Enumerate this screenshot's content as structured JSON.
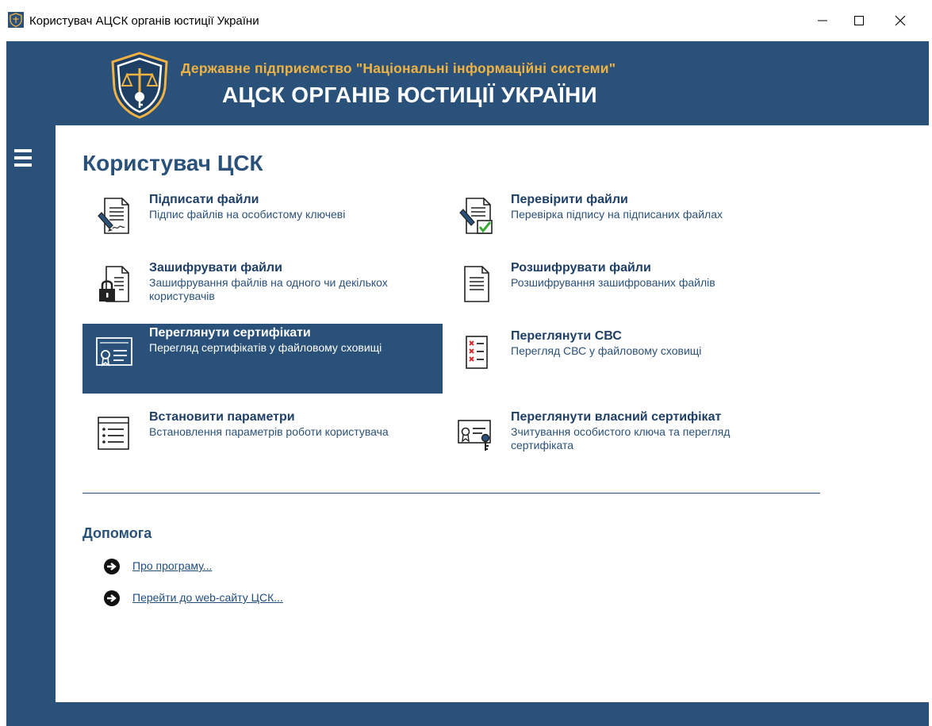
{
  "window": {
    "title": "Користувач АЦСК органів юстиції України",
    "controls": [
      "minimize",
      "maximize",
      "close"
    ]
  },
  "banner": {
    "subtitle": "Державне підприємство \"Національні інформаційні системи\"",
    "title": "АЦСК ОРГАНІВ ЮСТИЦІЇ УКРАЇНИ"
  },
  "page": {
    "title": "Користувач ЦСК"
  },
  "actions": [
    {
      "title": "Підписати файли",
      "description": "Підпис файлів на особистому ключеві",
      "icon": "sign-document-icon"
    },
    {
      "title": "Перевірити файли",
      "description": "Перевірка підпису на підписаних файлах",
      "icon": "verify-document-icon"
    },
    {
      "title": "Зашифрувати файли",
      "description": "Зашифрування файлів на одного чи декількох користувачів",
      "icon": "encrypt-document-icon"
    },
    {
      "title": "Розшифрувати файли",
      "description": "Розшифрування зашифрованих файлів",
      "icon": "decrypt-document-icon"
    },
    {
      "title": "Переглянути сертифікати",
      "description": "Перегляд сертифікатів у файловому сховищі",
      "icon": "certificate-icon",
      "selected": true
    },
    {
      "title": "Переглянути СВС",
      "description": "Перегляд СВС у файловому сховищі",
      "icon": "revocation-list-icon"
    },
    {
      "title": "Встановити параметри",
      "description": "Встановлення параметрів роботи користувача",
      "icon": "settings-list-icon"
    },
    {
      "title": "Переглянути власний сертифікат",
      "description": "Зчитування особистого ключа та перегляд сертифіката",
      "icon": "own-certificate-key-icon"
    }
  ],
  "help": {
    "title": "Допомога",
    "links": [
      {
        "label": "Про програму...",
        "icon": "arrow-right-circle-icon"
      },
      {
        "label": "Перейти до web-сайту ЦСК...",
        "icon": "arrow-right-circle-icon"
      }
    ]
  },
  "colors": {
    "frame": "#2a5179",
    "banner_subtitle": "#f0b243",
    "selected_tile": "#2a5179",
    "link": "#1f4d7d"
  }
}
